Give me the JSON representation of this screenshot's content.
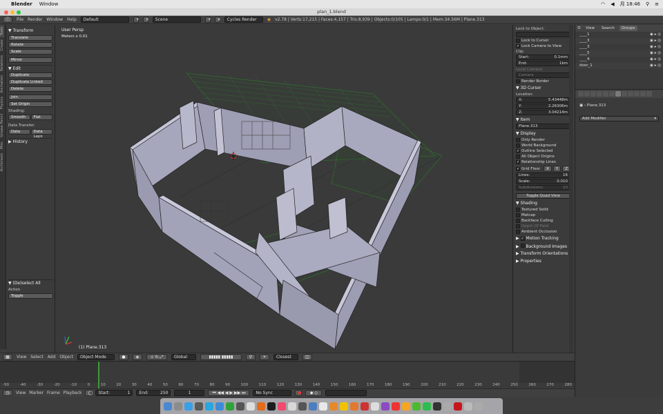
{
  "menubar": {
    "app": "Blender",
    "items": [
      "Window"
    ],
    "clock": "月 18:46"
  },
  "window": {
    "title": "plan_1.blend"
  },
  "info": {
    "menus": [
      "File",
      "Render",
      "Window",
      "Help"
    ],
    "layout": "Default",
    "scene": "Scene",
    "engine": "Cycles Render",
    "stats": "v2.78 | Verts:17,215 | Faces:4,157 | Tris:8,939 | Objects:0/105 | Lamps:0/1 | Mem:34.56M | Plane.313"
  },
  "tabs": [
    "Tools",
    "Create",
    "Relations",
    "Animation",
    "Physics",
    "Grease Pencil",
    "Misc",
    "Archimesh"
  ],
  "tools": {
    "transform_h": "Transform",
    "translate": "Translate",
    "rotate": "Rotate",
    "scale": "Scale",
    "mirror": "Mirror",
    "edit_h": "Edit",
    "duplicate": "Duplicate",
    "duplicate_linked": "Duplicate Linked",
    "delete": "Delete",
    "join": "Join",
    "set_origin": "Set Origin",
    "shading_l": "Shading:",
    "smooth": "Smooth",
    "flat": "Flat",
    "data_transfer_l": "Data Transfer:",
    "data": "Data",
    "data_layo": "Data Layo",
    "history_h": "History",
    "deselect_h": "(De)select All",
    "action_l": "Action",
    "action_val": "Toggle"
  },
  "viewport": {
    "view_name": "User Persp",
    "grid_scale": "Meters x 0.01",
    "object_label": "(1) Plane.313"
  },
  "npanel": {
    "lock_to_object": "Lock to Object:",
    "lock_to_cursor": "Lock to Cursor",
    "lock_camera": "Lock Camera to View",
    "clip_l": "Clip:",
    "clip_start_l": "Start:",
    "clip_start": "0.1mm",
    "clip_end_l": "End:",
    "clip_end": "1km",
    "local_camera_l": "Local Camera:",
    "camera": "Camera",
    "render_border": "Render Border",
    "cursor_h": "3D Cursor",
    "location_l": "Location:",
    "cx_l": "X:",
    "cx": "5.43448m",
    "cy_l": "Y:",
    "cy": "2.26306m",
    "cz_l": "Z:",
    "cz": "3.04214m",
    "item_h": "Item",
    "item_name": "Plane.313",
    "display_h": "Display",
    "only_render": "Only Render",
    "world_bg": "World Background",
    "outline_sel": "Outline Selected",
    "all_origins": "All Object Origins",
    "rel_lines": "Relationship Lines",
    "grid_floor": "Grid Floor",
    "axis_x": "X",
    "axis_y": "Y",
    "axis_z": "Z",
    "lines_l": "Lines:",
    "lines": "16",
    "scale_l": "Scale:",
    "scale": "0.010",
    "subdiv_l": "Subdivisions:",
    "subdiv": "10",
    "toggle_quad": "Toggle Quad View",
    "shading_h": "Shading",
    "textured_solid": "Textured Solid",
    "matcap": "Matcap",
    "backface": "Backface Culling",
    "dof": "Depth Of Field",
    "ao": "Ambient Occlusion",
    "motion_tracking": "Motion Tracking",
    "bg_images": "Background Images",
    "transform_orient": "Transform Orientations",
    "properties": "Properties"
  },
  "outliner": {
    "tabs": [
      "View",
      "Search",
      "Groups"
    ],
    "rows": [
      "____1",
      "____3",
      "____3",
      "____5",
      "____4",
      "door_1"
    ]
  },
  "props": {
    "object": "Plane.313",
    "add_modifier": "Add Modifier"
  },
  "vpheader": {
    "view": "View",
    "select": "Select",
    "add": "Add",
    "object": "Object",
    "mode": "Object Mode",
    "orientation": "Global",
    "snap": "Closest"
  },
  "timeline": {
    "ticks": [
      "-50",
      "-40",
      "-30",
      "-20",
      "-10",
      "0",
      "10",
      "20",
      "30",
      "40",
      "50",
      "60",
      "70",
      "80",
      "90",
      "100",
      "110",
      "120",
      "130",
      "140",
      "150",
      "160",
      "170",
      "180",
      "190",
      "200",
      "210",
      "220",
      "230",
      "240",
      "250",
      "260",
      "270",
      "280"
    ],
    "view": "View",
    "marker": "Marker",
    "frame": "Frame",
    "playback": "Playback",
    "start_l": "Start:",
    "start": "1",
    "end_l": "End:",
    "end": "250",
    "current": "1",
    "sync": "No Sync"
  },
  "colors": {
    "wall": "#aeaec4",
    "grid_green": "#2f6b2f",
    "bg": "#3a3a3a"
  }
}
